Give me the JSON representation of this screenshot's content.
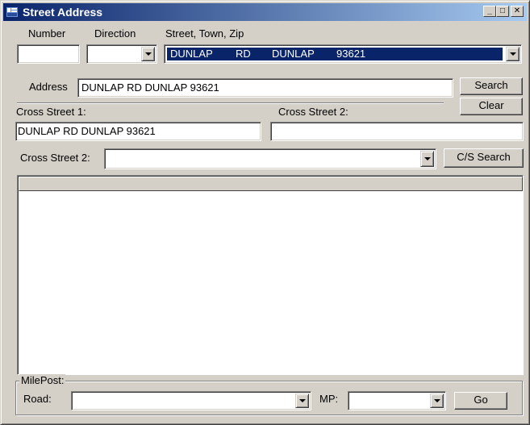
{
  "window": {
    "title": "Street Address",
    "controls": {
      "minimize": "_",
      "maximize": "□",
      "close": "✕"
    }
  },
  "labels": {
    "number": "Number",
    "direction": "Direction",
    "street_town_zip": "Street, Town, Zip",
    "address": "Address",
    "cross_street_1": "Cross Street 1:",
    "cross_street_2_header": "Cross Street 2:",
    "cross_street_2": "Cross Street 2:"
  },
  "fields": {
    "number": {
      "value": ""
    },
    "direction": {
      "value": ""
    },
    "street_combo": {
      "street": "DUNLAP",
      "type": "RD",
      "town": "DUNLAP",
      "zip": "93621"
    },
    "address": {
      "value": "DUNLAP RD DUNLAP 93621"
    },
    "cross_street_1": {
      "value": "DUNLAP RD DUNLAP 93621"
    },
    "cross_street_2_text": {
      "value": ""
    },
    "cross_street_2_select": {
      "value": ""
    }
  },
  "buttons": {
    "search": "Search",
    "clear": "Clear",
    "cs_search": "C/S Search",
    "go": "Go"
  },
  "milepost": {
    "group_title": "MilePost:",
    "road_label": "Road:",
    "mp_label": "MP:",
    "road_value": "",
    "mp_value": ""
  },
  "colors": {
    "title_bar": "#0a246a",
    "selection": "#0a246a",
    "face": "#d4d0c8"
  }
}
